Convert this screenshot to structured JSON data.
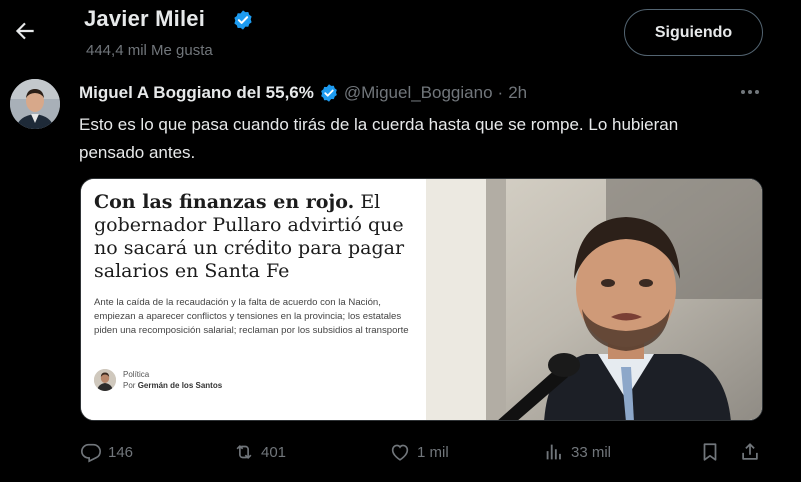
{
  "header": {
    "name": "Javier Milei",
    "likes_count": "444,4 mil Me gusta",
    "follow_label": "Siguiendo"
  },
  "tweet": {
    "author_name": "Miguel A Boggiano del 55,6%",
    "author_handle": "@Miguel_Boggiano",
    "separator": "·",
    "time": "2h",
    "text": "Esto es lo que pasa cuando tirás de la cuerda hasta que se rompe. Lo hubieran pensado antes."
  },
  "card": {
    "headline_bold": "Con las finanzas en rojo.",
    "headline_rest": "El gobernador Pullaro advirtió que no sacará un crédito para pagar salarios en Santa Fe",
    "subheadline": "Ante la caída de la recaudación y la falta de acuerdo con la Nación, empiezan a aparecer conflictos y tensiones en la provincia; los estatales piden una recomposición salarial; reclaman por los subsidios al transporte",
    "section": "Política",
    "byline_prefix": "Por",
    "byline_author": "Germán de los Santos"
  },
  "actions": {
    "replies": "146",
    "reposts": "401",
    "likes": "1 mil",
    "views": "33 mil"
  },
  "colors": {
    "background": "#000000",
    "primary_text": "#e7e9ea",
    "secondary_text": "#71767b",
    "verified_blue": "#1d9bf0",
    "border": "#536471"
  },
  "icons": [
    "back-arrow-icon",
    "verified-icon",
    "more-icon",
    "reply-icon",
    "repost-icon",
    "like-icon",
    "views-icon",
    "bookmark-icon",
    "share-icon"
  ]
}
